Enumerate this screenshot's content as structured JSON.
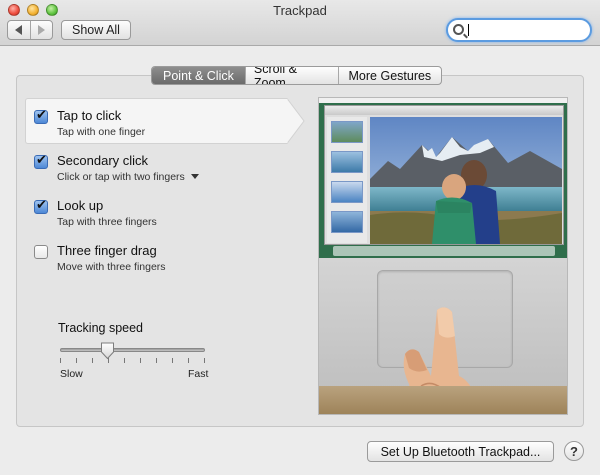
{
  "window": {
    "title": "Trackpad",
    "show_all_label": "Show All"
  },
  "search": {
    "value": "",
    "placeholder": ""
  },
  "tabs": [
    {
      "label": "Point & Click",
      "active": true
    },
    {
      "label": "Scroll & Zoom",
      "active": false
    },
    {
      "label": "More Gestures",
      "active": false
    }
  ],
  "options": [
    {
      "title": "Tap to click",
      "subtitle": "Tap with one finger",
      "checked": true,
      "selected": true
    },
    {
      "title": "Secondary click",
      "subtitle": "Click or tap with two fingers",
      "checked": true,
      "has_dropdown": true
    },
    {
      "title": "Look up",
      "subtitle": "Tap with three fingers",
      "checked": true
    },
    {
      "title": "Three finger drag",
      "subtitle": "Move with three fingers",
      "checked": false
    }
  ],
  "tracking": {
    "label": "Tracking speed",
    "min_label": "Slow",
    "max_label": "Fast",
    "value_fraction": 0.33,
    "tick_count": 10
  },
  "footer": {
    "setup_label": "Set Up Bluetooth Trackpad...",
    "help_label": "?"
  },
  "colors": {
    "accent": "#4d88d6",
    "search_focus": "#5b9be0"
  },
  "icons": [
    "back-arrow-icon",
    "forward-arrow-icon",
    "search-icon",
    "checkbox-icon",
    "dropdown-arrow-icon",
    "help-icon"
  ]
}
